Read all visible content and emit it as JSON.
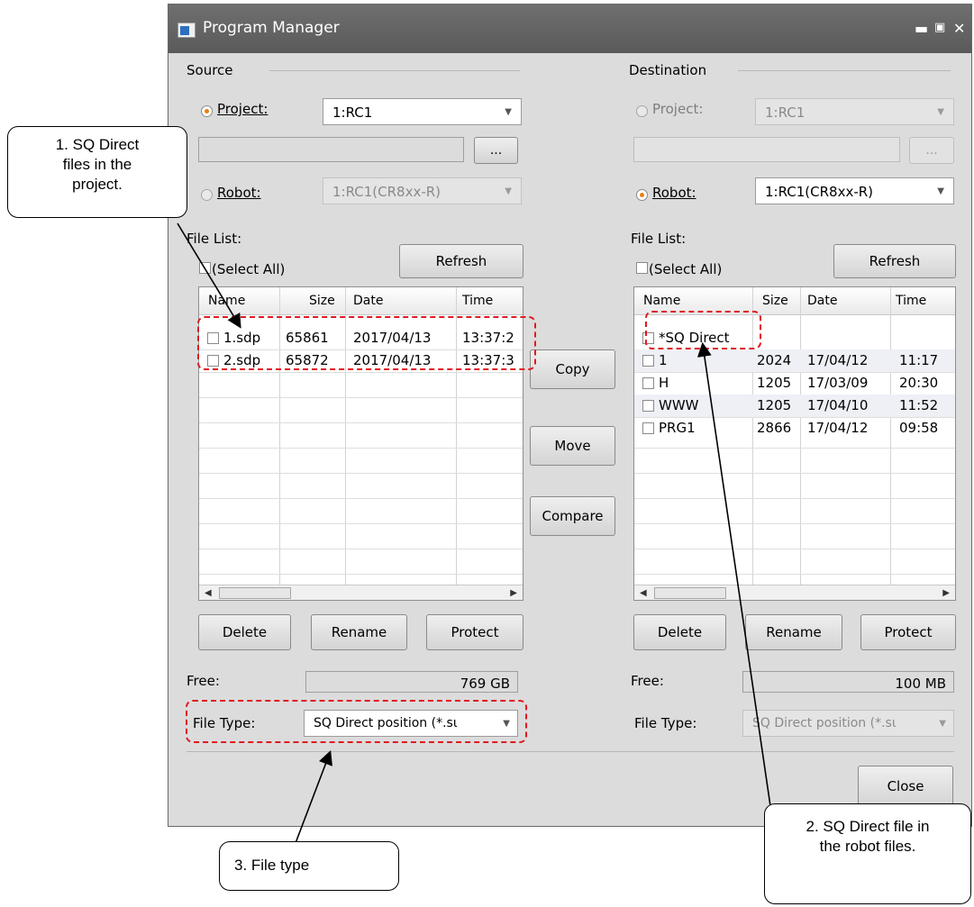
{
  "window": {
    "title": "Program Manager"
  },
  "source": {
    "heading": "Source",
    "project_label": "Project:",
    "project_value": "1:RC1",
    "browse_label": "...",
    "robot_label": "Robot:",
    "robot_value": "1:RC1(CR8xx-R)",
    "file_list_label": "File List:",
    "select_all_label": "(Select All)",
    "refresh_label": "Refresh",
    "columns": [
      "Name",
      "Size",
      "Date",
      "Time"
    ],
    "rows": [
      {
        "name": "1.sdp",
        "size": "65861",
        "date": "2017/04/13",
        "time": "13:37:2"
      },
      {
        "name": "2.sdp",
        "size": "65872",
        "date": "2017/04/13",
        "time": "13:37:3"
      }
    ],
    "delete_label": "Delete",
    "rename_label": "Rename",
    "protect_label": "Protect",
    "free_label": "Free:",
    "free_value": "769 GB",
    "file_type_label": "File Type:",
    "file_type_value": "SQ Direct position (*.sι"
  },
  "middle": {
    "copy_label": "Copy",
    "move_label": "Move",
    "compare_label": "Compare"
  },
  "destination": {
    "heading": "Destination",
    "project_label": "Project:",
    "project_value": "1:RC1",
    "browse_label": "...",
    "robot_label": "Robot:",
    "robot_value": "1:RC1(CR8xx-R)",
    "file_list_label": "File List:",
    "select_all_label": "(Select All)",
    "refresh_label": "Refresh",
    "columns": [
      "Name",
      "Size",
      "Date",
      "Time"
    ],
    "rows": [
      {
        "name": "*SQ Direct",
        "size": "",
        "date": "",
        "time": ""
      },
      {
        "name": "1",
        "size": "2024",
        "date": "17/04/12",
        "time": "11:17"
      },
      {
        "name": "H",
        "size": "1205",
        "date": "17/03/09",
        "time": "20:30"
      },
      {
        "name": "WWW",
        "size": "1205",
        "date": "17/04/10",
        "time": "11:52"
      },
      {
        "name": "PRG1",
        "size": "2866",
        "date": "17/04/12",
        "time": "09:58"
      }
    ],
    "delete_label": "Delete",
    "rename_label": "Rename",
    "protect_label": "Protect",
    "free_label": "Free:",
    "free_value": "100 MB",
    "file_type_label": "File Type:",
    "file_type_value": "SQ Direct position (*.sι"
  },
  "close_label": "Close",
  "annotations": {
    "note1": [
      "1. SQ Direct",
      "files in the",
      "project."
    ],
    "note2": [
      "2. SQ Direct file in",
      "the robot files."
    ],
    "note3": "3. File type"
  }
}
